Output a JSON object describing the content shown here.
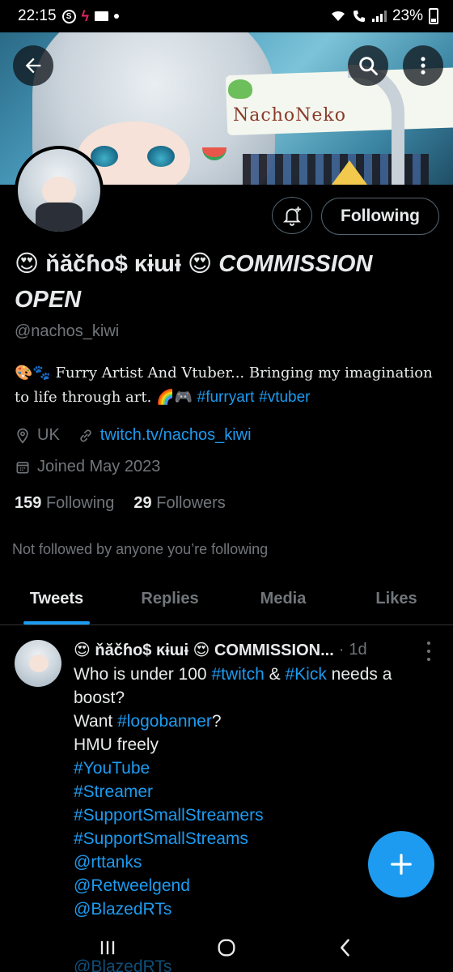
{
  "status_bar": {
    "time": "22:15",
    "battery": "23%",
    "icons": [
      "skype-icon",
      "flash-icon",
      "mail-icon",
      "dot-icon",
      "wifi-icon",
      "call-icon",
      "signal-icon",
      "battery-icon"
    ]
  },
  "banner": {
    "sign_text": "NachoNeko"
  },
  "header": {
    "back_icon": "arrow-left-icon",
    "search_icon": "search-icon",
    "more_icon": "more-vertical-icon"
  },
  "profile": {
    "name_emoji_left": "😍",
    "name_core": "ňăčɦo$ ĸɨɯɨ",
    "name_emoji_right": "😍",
    "name_suffix": "COMMISSION OPEN",
    "handle": "@nachos_kiwi",
    "bio_prefix_emoji": "🎨🐾",
    "bio_text": "Furry Artist And Vtuber... Bringing my imagination to life through art.",
    "bio_suffix_emoji": "🌈🎮",
    "bio_tags": [
      "#furryart",
      "#vtuber"
    ],
    "location": "UK",
    "website": "twitch.tv/nachos_kiwi",
    "joined": "Joined May 2023",
    "following_count": "159",
    "following_label": "Following",
    "followers_count": "29",
    "followers_label": "Followers",
    "not_followed_text": "Not followed by anyone you’re following",
    "follow_button_label": "Following"
  },
  "tabs": [
    {
      "label": "Tweets",
      "active": true
    },
    {
      "label": "Replies",
      "active": false
    },
    {
      "label": "Media",
      "active": false
    },
    {
      "label": "Likes",
      "active": false
    }
  ],
  "tweet": {
    "author_display": "😍 ňăčɦo$ ĸɨɯɨ 😍 COMMISSION...",
    "separator": "·",
    "time": "1d",
    "text_line1_a": "Who is under 100 ",
    "tag_twitch": "#twitch",
    "text_and": " & ",
    "tag_kick": "#Kick",
    "text_line1_b": " needs a boost?",
    "text_want": "Want ",
    "tag_logobanner": "#logobanner",
    "text_q": "?",
    "text_hmu": "HMU freely",
    "tags": [
      "#YouTube",
      "#Streamer",
      "#SupportSmallStreamers",
      "#SupportSmallStreams",
      "@rttanks",
      "@Retweelgend",
      "@BlazedRTs"
    ],
    "ghost_line": "@BlazedRTs"
  },
  "colors": {
    "accent": "#1d9bf0",
    "background": "#000000",
    "text_primary": "#e7e9ea",
    "text_secondary": "#71767b",
    "border": "#2f3336"
  }
}
